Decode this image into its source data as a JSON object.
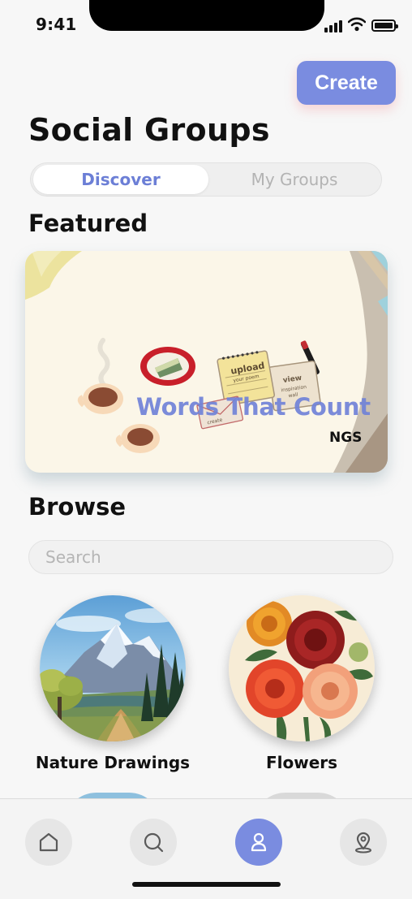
{
  "status_bar": {
    "time": "9:41"
  },
  "header": {
    "create_label": "Create",
    "title": "Social Groups"
  },
  "tabs": [
    {
      "label": "Discover",
      "active": true
    },
    {
      "label": "My Groups",
      "active": false
    }
  ],
  "featured": {
    "section_title": "Featured",
    "card": {
      "title": "Words That Count",
      "subtitle": "NGS"
    }
  },
  "browse": {
    "section_title": "Browse",
    "search_placeholder": "Search",
    "groups": [
      {
        "label": "Nature Drawings",
        "icon": "mountain-painting-image"
      },
      {
        "label": "Flowers",
        "icon": "dahlia-flowers-image"
      }
    ]
  },
  "bottom_nav": {
    "items": [
      {
        "icon": "home-icon",
        "active": false
      },
      {
        "icon": "search-icon",
        "active": false
      },
      {
        "icon": "profile-icon",
        "active": true
      },
      {
        "icon": "location-icon",
        "active": false
      }
    ]
  },
  "colors": {
    "accent": "#7a8ce0",
    "background": "#f7f7f7",
    "card": "#fbf6e8"
  }
}
